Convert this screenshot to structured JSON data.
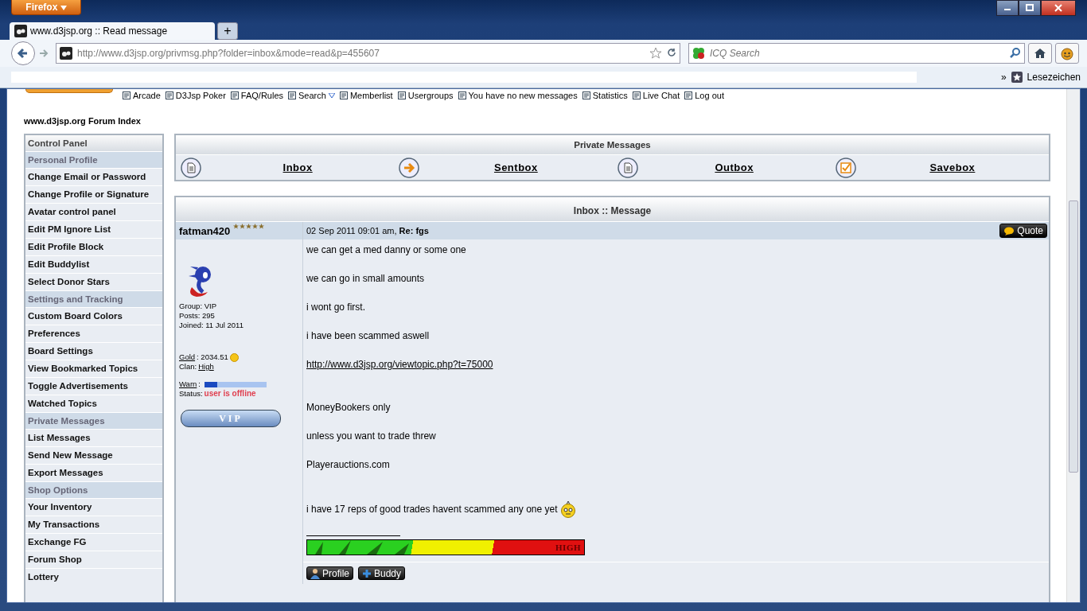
{
  "browser": {
    "menu_button": "Firefox",
    "tabs": [
      {
        "title": "www.d3jsp.org :: Read message",
        "selected": true
      }
    ],
    "new_tab": "+",
    "url": "http://www.d3jsp.org/privmsg.php?folder=inbox&mode=read&p=455607",
    "search_placeholder": "ICQ Search",
    "bookmarks_overflow": "»",
    "bookmarks_label": "Lesezeichen"
  },
  "nav_links": [
    {
      "label": "Arcade"
    },
    {
      "label": "D3Jsp Poker"
    },
    {
      "label": "FAQ/Rules"
    },
    {
      "label": "Search",
      "dropdown": true
    },
    {
      "label": "Memberlist"
    },
    {
      "label": "Usergroups"
    },
    {
      "label": "You have no new messages"
    },
    {
      "label": "Statistics"
    },
    {
      "label": "Live Chat"
    },
    {
      "label": "Log out"
    }
  ],
  "breadcrumb": "www.d3jsp.org Forum Index",
  "sidebar": [
    {
      "kind": "title",
      "label": "Control Panel"
    },
    {
      "kind": "section",
      "label": "Personal Profile"
    },
    {
      "kind": "link",
      "label": "Change Email or Password"
    },
    {
      "kind": "link",
      "label": "Change Profile or Signature"
    },
    {
      "kind": "link",
      "label": "Avatar control panel"
    },
    {
      "kind": "link",
      "label": "Edit PM Ignore List"
    },
    {
      "kind": "link",
      "label": "Edit Profile Block"
    },
    {
      "kind": "link",
      "label": "Edit Buddylist"
    },
    {
      "kind": "link",
      "label": "Select Donor Stars"
    },
    {
      "kind": "section",
      "label": "Settings and Tracking"
    },
    {
      "kind": "link",
      "label": "Custom Board Colors"
    },
    {
      "kind": "link",
      "label": "Preferences"
    },
    {
      "kind": "link",
      "label": "Board Settings"
    },
    {
      "kind": "link",
      "label": "View Bookmarked Topics"
    },
    {
      "kind": "link",
      "label": "Toggle Advertisements"
    },
    {
      "kind": "link",
      "label": "Watched Topics"
    },
    {
      "kind": "section",
      "label": "Private Messages"
    },
    {
      "kind": "link",
      "label": "List Messages"
    },
    {
      "kind": "link",
      "label": "Send New Message"
    },
    {
      "kind": "link",
      "label": "Export Messages"
    },
    {
      "kind": "section",
      "label": "Shop Options"
    },
    {
      "kind": "link",
      "label": "Your Inventory"
    },
    {
      "kind": "link",
      "label": "My Transactions"
    },
    {
      "kind": "link",
      "label": "Exchange FG"
    },
    {
      "kind": "link",
      "label": "Forum Shop"
    },
    {
      "kind": "link",
      "label": "Lottery"
    }
  ],
  "pm_box": {
    "title": "Private Messages",
    "folders": [
      {
        "kind": "inbox",
        "label": "Inbox"
      },
      {
        "kind": "sent",
        "label": "Sentbox"
      },
      {
        "kind": "outbox",
        "label": "Outbox"
      },
      {
        "kind": "save",
        "label": "Savebox"
      }
    ]
  },
  "message": {
    "title": "Inbox :: Message",
    "author": "fatman420",
    "stars": 5,
    "info": [
      "Group: VIP",
      "Posts: 295",
      "Joined: 11 Jul 2011"
    ],
    "gold_label": "Gold",
    "gold_value": ": 2034.51",
    "clan_label": ": ",
    "clan": "High",
    "clan_key": "Clan",
    "warn_label": "Warn",
    "warn_sep": ":",
    "warn": {
      "level": 0.2
    },
    "status_label": "Status:",
    "status": "user is offline",
    "rank": "VIP",
    "header": "02 Sep 2011 09:01 am, **Re: fgs**",
    "quote_button": "Quote",
    "body": [
      {
        "kind": "text",
        "text": "we can get a med danny or some one"
      },
      {
        "kind": "text",
        "text": "we can go in small amounts"
      },
      {
        "kind": "text",
        "text": "i wont go first."
      },
      {
        "kind": "text",
        "text": "i have been scammed aswell"
      },
      {
        "kind": "link",
        "text": "http://www.d3jsp.org/viewtopic.php?t=75000"
      },
      {
        "kind": "break"
      },
      {
        "kind": "text",
        "text": "MoneyBookers only"
      },
      {
        "kind": "text",
        "text": "unless you want to trade threw"
      },
      {
        "kind": "text",
        "text": "Playerauctions.com"
      },
      {
        "kind": "break"
      },
      {
        "kind": "smiley",
        "text": "i have 17 reps of good trades havent scammed any one yet"
      }
    ],
    "signature": "HIGH",
    "buttons": [
      {
        "kind": "profile",
        "label": "Profile"
      },
      {
        "kind": "buddy",
        "label": "Buddy"
      }
    ]
  }
}
